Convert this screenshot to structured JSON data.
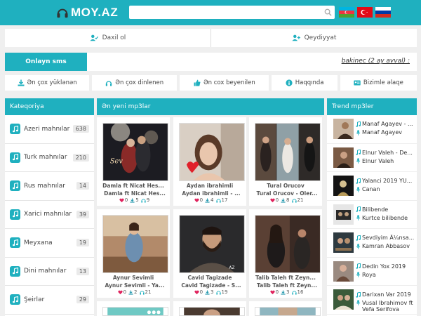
{
  "header": {
    "logo_text": "MOY.AZ",
    "search_placeholder": "",
    "flags": [
      "az-flag",
      "tr-flag",
      "ru-flag"
    ]
  },
  "auth": {
    "login_label": "Daxil ol",
    "register_label": "Qeydiyyat"
  },
  "online": {
    "label": "Onlayn sms",
    "marquee": "bakinec (2 ay avval) :"
  },
  "nav": [
    {
      "label": "Ən çox yüklənən",
      "icon": "download-icon"
    },
    {
      "label": "Ən çox dinlenen",
      "icon": "headphones-icon"
    },
    {
      "label": "Ən cox beyenilen",
      "icon": "thumbs-up-icon"
    },
    {
      "label": "Haqqında",
      "icon": "info-icon"
    },
    {
      "label": "Bizimle əlaqe",
      "icon": "contact-card-icon"
    }
  ],
  "sidebar": {
    "title": "Kateqoriya",
    "items": [
      {
        "label": "Azeri mahnılar",
        "count": "638"
      },
      {
        "label": "Turk mahnılar",
        "count": "210"
      },
      {
        "label": "Rus mahnılar",
        "count": "14"
      },
      {
        "label": "Xarici mahnılar",
        "count": "39"
      },
      {
        "label": "Meyxana",
        "count": "19"
      },
      {
        "label": "Dini mahnılar",
        "count": "13"
      },
      {
        "label": "Şeirlər",
        "count": "29"
      }
    ]
  },
  "center": {
    "title": "Ən yeni mp3lar",
    "cards": [
      {
        "artist": "Damla ft Nicat Hes...",
        "title": "Damla ft Nicat Hes...",
        "likes": "0",
        "downloads": "5",
        "listens": "9"
      },
      {
        "artist": "Aydan ibrahimli",
        "title": "Aydan ibrahimli - ...",
        "likes": "0",
        "downloads": "4",
        "listens": "17"
      },
      {
        "artist": "Tural Orucov",
        "title": "Tural Orucov - Oler...",
        "likes": "0",
        "downloads": "8",
        "listens": "21"
      },
      {
        "artist": "Aynur Sevimli",
        "title": "Aynur Sevimli - Ya...",
        "likes": "0",
        "downloads": "2",
        "listens": "21"
      },
      {
        "artist": "Cavid Tagizade",
        "title": "Cavid Tagizade - S...",
        "likes": "0",
        "downloads": "3",
        "listens": "19"
      },
      {
        "artist": "Talib Taleh ft Zeyn...",
        "title": "Talib Taleh ft Zeyn...",
        "likes": "0",
        "downloads": "3",
        "listens": "16"
      }
    ]
  },
  "trend": {
    "title": "Trend mp3ler",
    "items": [
      {
        "song": "Manaf Agayev - ...",
        "artist": "Manaf Agayev"
      },
      {
        "song": "Elnur Valeh - De...",
        "artist": "Elnur Valeh"
      },
      {
        "song": "Yalanci 2019 YU...",
        "artist": "Canan"
      },
      {
        "song": "Bilibende",
        "artist": "Kurtce bilibende"
      },
      {
        "song": "Sevdiyim Ã¼nsa...",
        "artist": "Kamran Abbasov"
      },
      {
        "song": "Dedin Yox 2019",
        "artist": "Roya"
      },
      {
        "song": "Darixan Var 2019",
        "artist": "Vusal Ibrahimov ft Vefa Serifova"
      }
    ]
  },
  "colors": {
    "accent": "#1fb0bf",
    "heart": "#e0245e",
    "download": "#2a9bb0",
    "headphone": "#1fb0bf"
  }
}
